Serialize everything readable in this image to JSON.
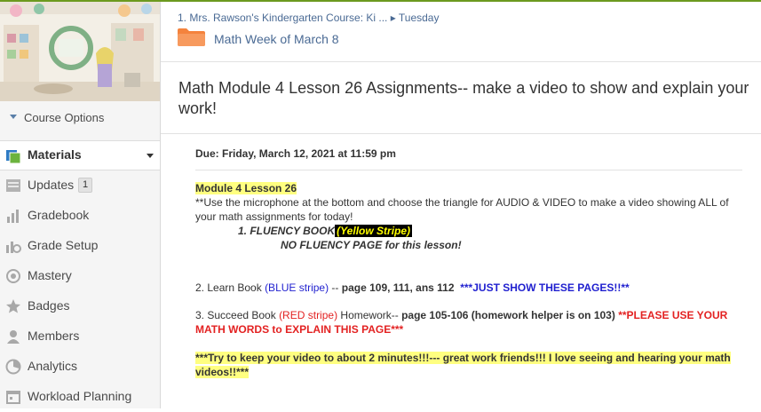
{
  "breadcrumb": {
    "course": "1. Mrs. Rawson's Kindergarten Course: Ki ...",
    "separator": "▸",
    "current": "Tuesday"
  },
  "folder": {
    "title": "Math Week of March 8",
    "color": "#f4833d"
  },
  "sidebar": {
    "course_options": "Course Options",
    "items": [
      {
        "label": "Materials",
        "icon": "materials-icon"
      },
      {
        "label": "Updates",
        "badge": "1",
        "icon": "updates-icon"
      },
      {
        "label": "Gradebook",
        "icon": "gradebook-icon"
      },
      {
        "label": "Grade Setup",
        "icon": "grade-setup-icon"
      },
      {
        "label": "Mastery",
        "icon": "mastery-icon"
      },
      {
        "label": "Badges",
        "icon": "badges-icon"
      },
      {
        "label": "Members",
        "icon": "members-icon"
      },
      {
        "label": "Analytics",
        "icon": "analytics-icon"
      },
      {
        "label": "Workload Planning",
        "icon": "workload-planning-icon"
      }
    ]
  },
  "assignment": {
    "title": "Math Module 4 Lesson 26 Assignments-- make a video to show and explain your work!",
    "due": "Due: Friday, March 12, 2021 at 11:59 pm",
    "module": "Module 4  Lesson 26",
    "instr1": "**Use the microphone at the bottom and choose the triangle for AUDIO & VIDEO to make a video showing ALL of",
    "instr2": "your math assignments for today!",
    "fluency_label": "1. FLUENCY BOOK",
    "fluency_stripe": "(Yellow Stripe)",
    "no_fluency": "NO FLUENCY PAGE for this lesson!",
    "learn_prefix": "2.  Learn Book ",
    "learn_stripe": "(BLUE stripe)",
    "learn_mid": " -- ",
    "learn_pages": "page 109, 111, ans 112",
    "learn_note": "***JUST SHOW THESE PAGES!!**",
    "succeed_prefix": "3. Succeed Book ",
    "succeed_stripe": "(RED stripe)",
    "succeed_mid": " Homework-- ",
    "succeed_pages": "page 105-106  (homework helper is on 103)",
    "succeed_note1": " **PLEASE USE YOUR",
    "succeed_note2": "MATH WORDS to EXPLAIN THIS PAGE***",
    "closing1": "***Try to keep your video to about 2 minutes!!!--- great work friends!!!  I love seeing and hearing your math",
    "closing2": "videos!!***"
  }
}
